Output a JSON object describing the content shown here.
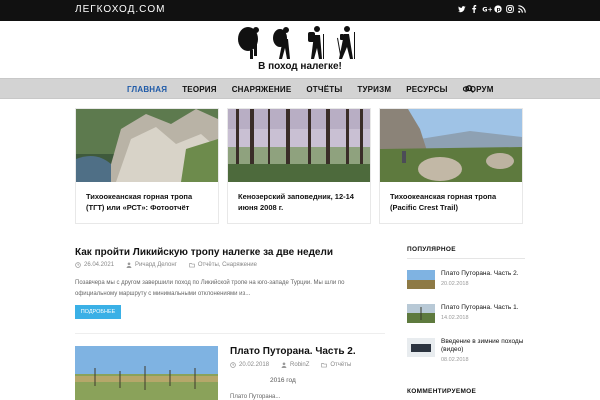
{
  "topbar": {
    "brand": "ЛЕГКОХОД.COM",
    "social": [
      {
        "name": "twitter-icon",
        "glyph": "t"
      },
      {
        "name": "facebook-icon",
        "glyph": "f"
      },
      {
        "name": "google-plus-icon",
        "glyph": "G"
      },
      {
        "name": "pinterest-icon",
        "glyph": "P"
      },
      {
        "name": "instagram-icon",
        "glyph": "◎"
      },
      {
        "name": "rss-icon",
        "glyph": "≈"
      }
    ]
  },
  "logo": {
    "tagline": "В поход налегке!"
  },
  "nav": {
    "items": [
      "ГЛАВНАЯ",
      "ТЕОРИЯ",
      "СНАРЯЖЕНИЕ",
      "ОТЧЁТЫ",
      "ТУРИЗМ",
      "РЕСУРСЫ",
      "ФОРУМ"
    ],
    "active": 0
  },
  "featured": [
    {
      "title": "Тихоокеанская горная тропа (ТГТ) или «РСТ»: Фотоотчёт"
    },
    {
      "title": "Кенозерский заповедник, 12-14 июня 2008 г."
    },
    {
      "title": "Тихоокеанская горная тропа (Pacific Crest Trail)"
    }
  ],
  "post": {
    "title": "Как пройти Ликийскую тропу налегке за две недели",
    "date": "26.04.2021",
    "author": "Ричард Делонг",
    "categories": "Отчёты, Снаряжение",
    "excerpt_line1": "Позавчера мы с другом завершили поход по Ликийской тропе на юго-западе Турции. Мы шли по",
    "excerpt_line2": "официальному маршруту с минимальными отклонениями из...",
    "button": "ПОДРОБНЕЕ"
  },
  "post2": {
    "title": "Плато Путорана. Часть 2.",
    "date": "20.02.2018",
    "author": "RobinZ",
    "categories": "Отчёты",
    "year": "2016 год",
    "line": "Плато Путорана..."
  },
  "sidebar": {
    "popular_heading": "ПОПУЛЯРНОЕ",
    "popular": [
      {
        "title": "Плато Путорана. Часть 2.",
        "date": "20.02.2018"
      },
      {
        "title": "Плато Путорана. Часть 1.",
        "date": "14.02.2018"
      },
      {
        "title": "Введение в зимние походы (видео)",
        "date": "08.02.2018"
      }
    ],
    "commented_heading": "КОММЕНТИРУЕМОЕ"
  },
  "colors": {
    "accent": "#1e5aa8",
    "button": "#3ab0e6",
    "topbar": "#111111",
    "nav": "#d3d3d3"
  }
}
